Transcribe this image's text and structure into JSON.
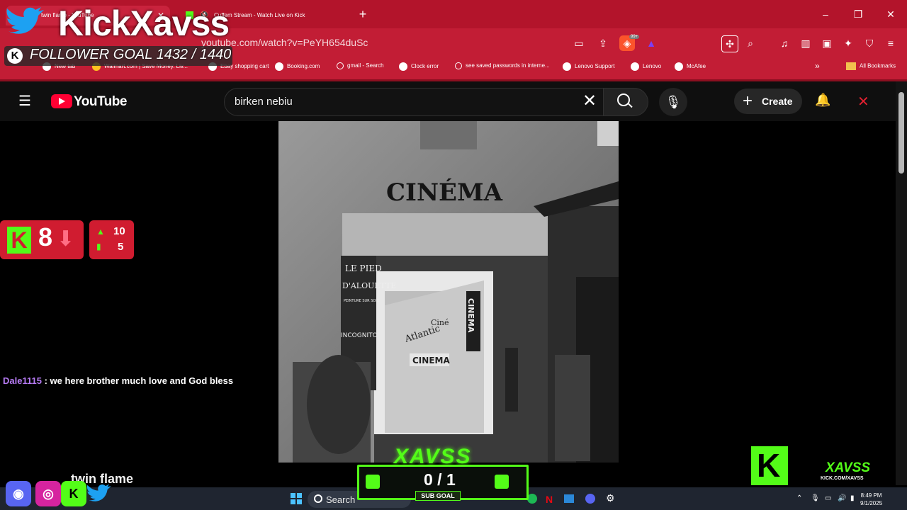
{
  "browser": {
    "tabs": [
      {
        "label": "twin flame - YouTube"
      },
      {
        "label": "Cuffem Stream - Watch Live on Kick"
      }
    ],
    "new_tab": "+",
    "url": "youtube.com/watch?v=PeYH654duSc",
    "extension_badge": "99+",
    "window_controls": {
      "minimize": "–",
      "restore": "❐",
      "close": "✕"
    },
    "bookmarks": [
      {
        "label": "New tab"
      },
      {
        "label": "Walmart.com | Save Money. Liv..."
      },
      {
        "label": "Ebay shopping cart"
      },
      {
        "label": "Booking.com"
      },
      {
        "label": "gmail - Search"
      },
      {
        "label": "Clock error"
      },
      {
        "label": "see saved passwords in interne..."
      },
      {
        "label": "Lenovo Support"
      },
      {
        "label": "Lenovo"
      },
      {
        "label": "McAfee"
      }
    ],
    "bookmarks_more": "»",
    "all_bookmarks": "All Bookmarks"
  },
  "youtube": {
    "logo_text": "YouTube",
    "search_query": "birken nebiu",
    "create_label": "Create",
    "video_title": "twin flame"
  },
  "overlay": {
    "channel_name": "KickXavss",
    "follower_goal": "FOLLOWER GOAL 1432 / 1440",
    "kick_count": "8",
    "stat_up": "10",
    "stat_bars": "5",
    "chat_user": "Dale1115",
    "chat_message": " : we here brother much love and God bless",
    "sub_goal_value": "0 / 1",
    "sub_goal_label": "SUB GOAL",
    "tag": "XAVSS",
    "brand_name": "XAVSS",
    "brand_url": "KICK.COM/XAVSS"
  },
  "photo": {
    "sign_main": "CINÉMA",
    "shop_sign_1": "LE PIED",
    "shop_sign_2": "D'ALOUETTE",
    "shop_sign_3": "PEINTURE SUR SOIE",
    "incognito": "INCOGNITO",
    "atlantic": "Atlantic",
    "cine": "Ciné",
    "inner_cinema": "CINEMA",
    "vertical_cinema": "CINEMA"
  },
  "taskbar": {
    "search_label": "Search",
    "time": "8:49 PM",
    "date": "9/1/2025"
  },
  "colors": {
    "chrome_red": "#c21d35",
    "kick_green": "#53fc18",
    "yt_red": "#ff0033"
  }
}
